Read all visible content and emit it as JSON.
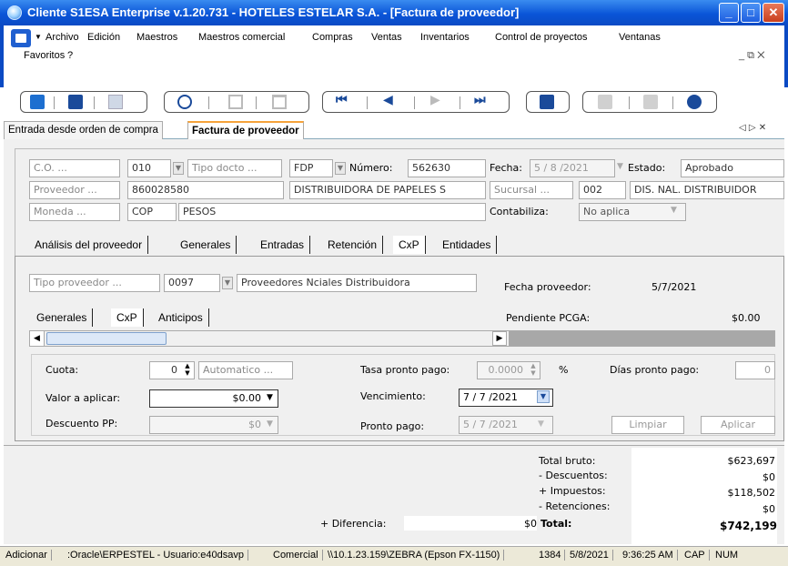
{
  "window": {
    "title": "Cliente S1ESA Enterprise v.1.20.731 - HOTELES ESTELAR S.A. - [Factura de proveedor]"
  },
  "menu": {
    "items": [
      "Archivo",
      "Edición",
      "Maestros",
      "Maestros comercial",
      "Compras",
      "Ventas",
      "Inventarios",
      "Control de proyectos",
      "Ventanas"
    ],
    "row2": [
      "Favoritos",
      "?"
    ]
  },
  "doc_tabs": [
    "Entrada desde orden de compra",
    "Factura de proveedor"
  ],
  "header": {
    "co_btn": "C.O. ...",
    "co_val": "010",
    "tipo_docto_btn": "Tipo docto ...",
    "tipo_docto_val": "FDP",
    "numero_lbl": "Número:",
    "numero_val": "562630",
    "fecha_lbl": "Fecha:",
    "fecha_val": "5 / 8 /2021",
    "estado_lbl": "Estado:",
    "estado_val": "Aprobado",
    "proveedor_btn": "Proveedor ...",
    "proveedor_nit": "860028580",
    "proveedor_nombre": "DISTRIBUIDORA DE PAPELES S",
    "sucursal_btn": "Sucursal ...",
    "sucursal_val": "002",
    "sucursal_nombre": "DIS. NAL. DISTRIBUIDOR",
    "moneda_btn": "Moneda ...",
    "moneda_val": "COP",
    "moneda_nombre": "PESOS",
    "contabiliza_lbl": "Contabiliza:",
    "contabiliza_val": "No aplica"
  },
  "tabs": [
    "Análisis del proveedor",
    "Generales",
    "Entradas",
    "Retención",
    "CxP",
    "Entidades"
  ],
  "cxp": {
    "tipo_prov_btn": "Tipo proveedor ...",
    "tipo_prov_val": "0097",
    "tipo_prov_nombre": "Proveedores Nciales Distribuidora",
    "fecha_prov_lbl": "Fecha proveedor:",
    "fecha_prov_val": "5/7/2021",
    "subtabs": [
      "Generales",
      "CxP",
      "Anticipos"
    ],
    "pendiente_lbl": "Pendiente PCGA:",
    "pendiente_val": "$0.00"
  },
  "cuota": {
    "cuota_lbl": "Cuota:",
    "cuota_val": "0",
    "automatico_btn": "Automatico ...",
    "tasa_lbl": "Tasa pronto pago:",
    "tasa_val": "0.0000",
    "pct": "%",
    "dias_lbl": "Días pronto pago:",
    "dias_val": "0",
    "valor_lbl": "Valor a aplicar:",
    "valor_val": "$0.00",
    "venc_lbl": "Vencimiento:",
    "venc_val": "7 / 7 /2021",
    "desc_lbl": "Descuento PP:",
    "desc_val": "$0",
    "pronto_lbl": "Pronto pago:",
    "pronto_val": "5 / 7 /2021",
    "limpiar": "Limpiar",
    "aplicar": "Aplicar"
  },
  "totals": {
    "bruto_lbl": "Total bruto:",
    "bruto_val": "$623,697",
    "desc_lbl": "- Descuentos:",
    "desc_val": "$0",
    "imp_lbl": "+ Impuestos:",
    "imp_val": "$118,502",
    "ret_lbl": "- Retenciones:",
    "ret_val": "$0",
    "dif_lbl": "+ Diferencia:",
    "dif_val": "$0",
    "total_lbl": "Total:",
    "total_val": "$742,199"
  },
  "status": [
    "Adicionar",
    ":Oracle\\ERPESTEL - Usuario:e40dsavp",
    "Comercial",
    "\\\\10.1.23.159\\ZEBRA (Epson FX-1150)",
    "1384",
    "5/8/2021",
    "9:36:25 AM",
    "CAP",
    "NUM"
  ]
}
